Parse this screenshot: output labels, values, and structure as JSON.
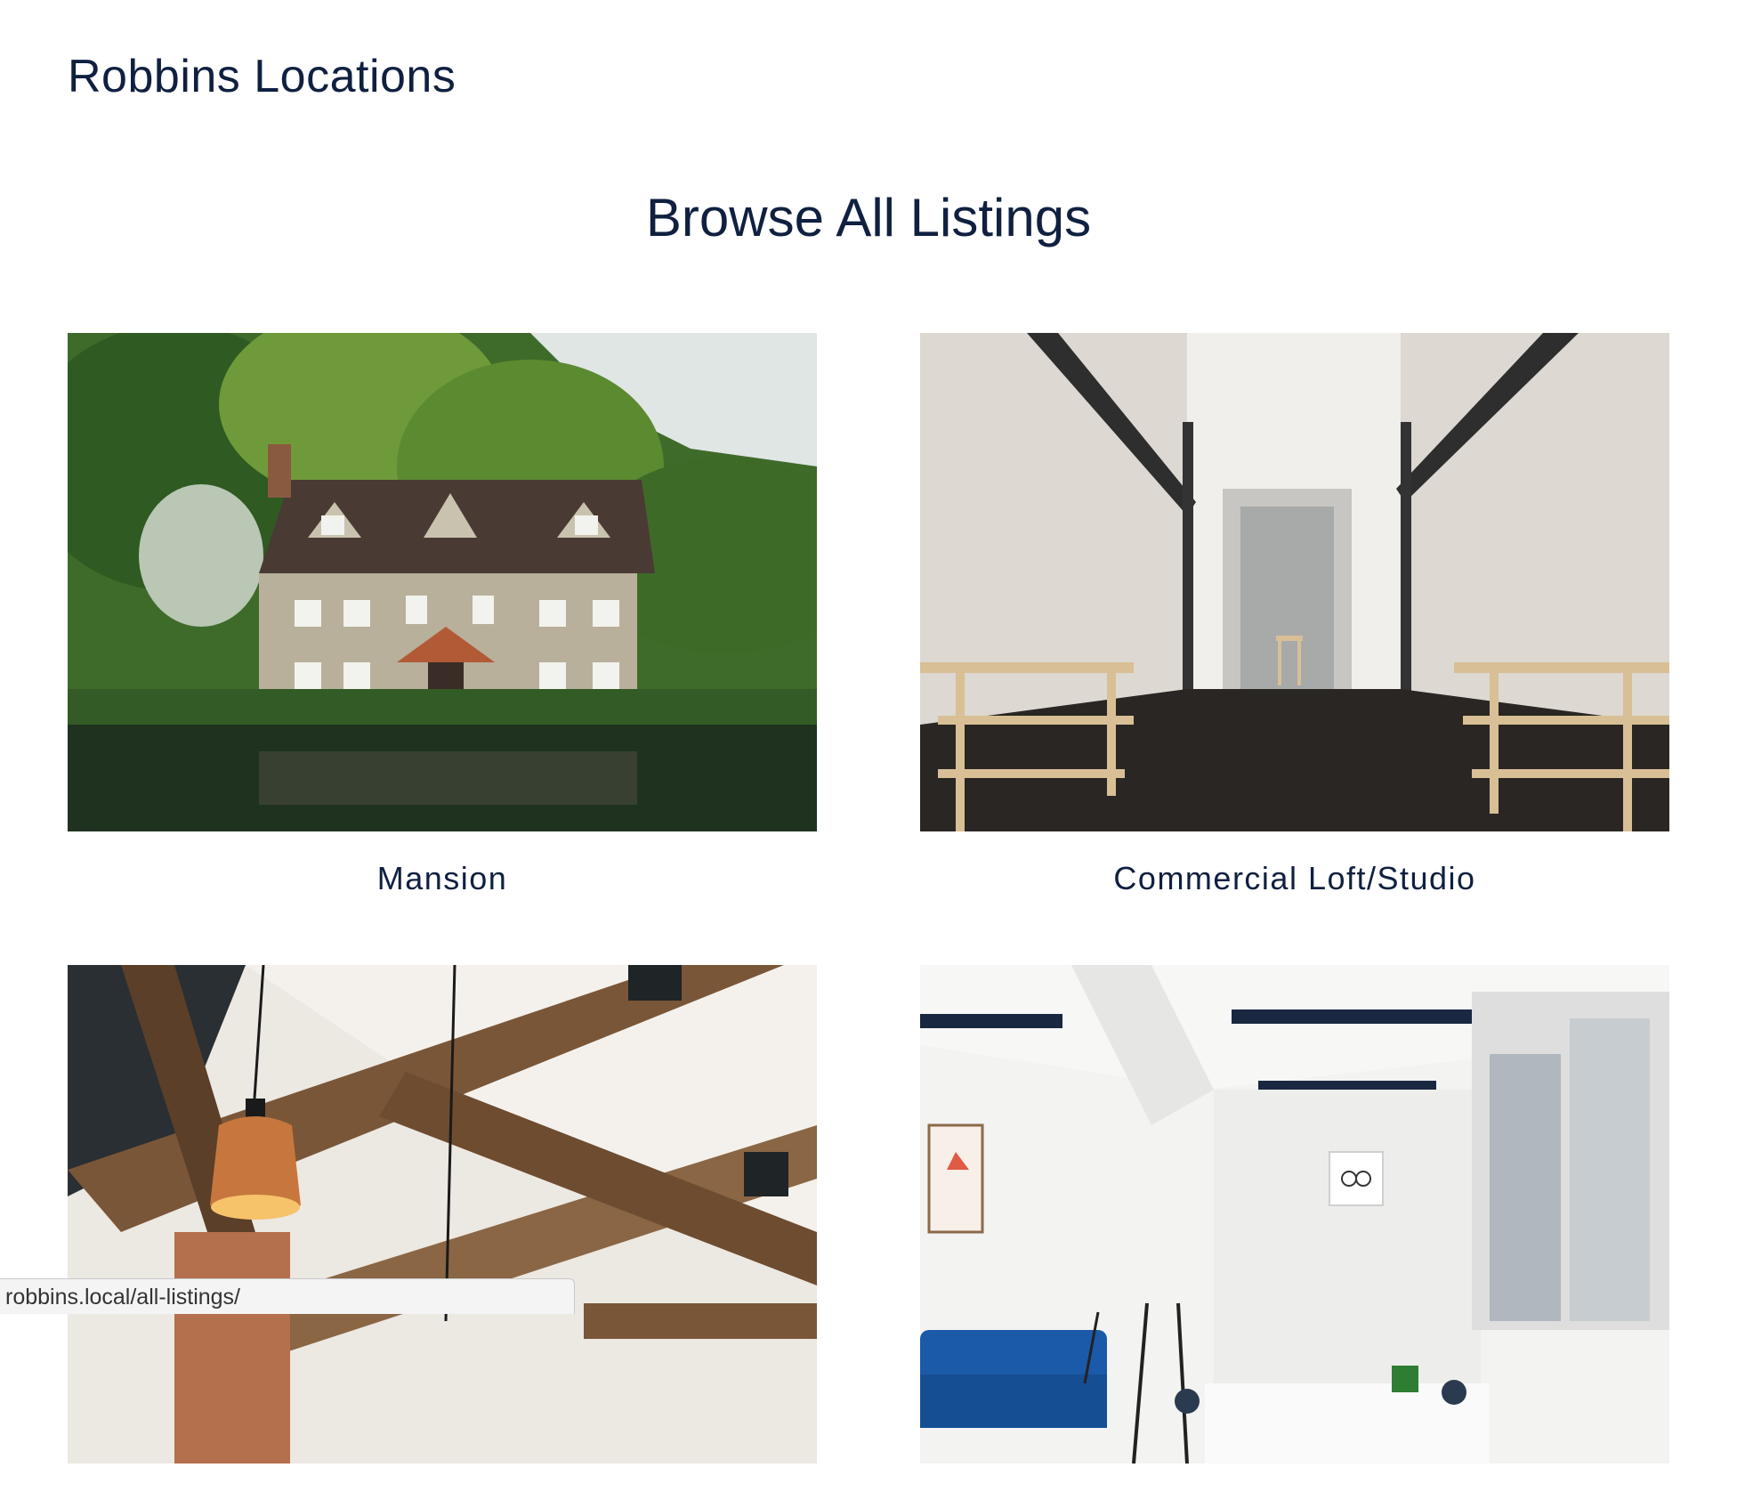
{
  "site": {
    "title": "Robbins Locations"
  },
  "main": {
    "heading": "Browse All Listings"
  },
  "listings": [
    {
      "label": "Mansion",
      "image": "house-by-lake-photo"
    },
    {
      "label": "Commercial Loft/Studio",
      "image": "loft-studio-interior-photo"
    },
    {
      "label": "",
      "image": "wooden-beams-pendant-lamp-photo"
    },
    {
      "label": "",
      "image": "white-office-room-photo"
    }
  ],
  "status_bar": {
    "url": "robbins.local/all-listings/"
  },
  "colors": {
    "text": "#0f2040",
    "background": "#ffffff"
  }
}
